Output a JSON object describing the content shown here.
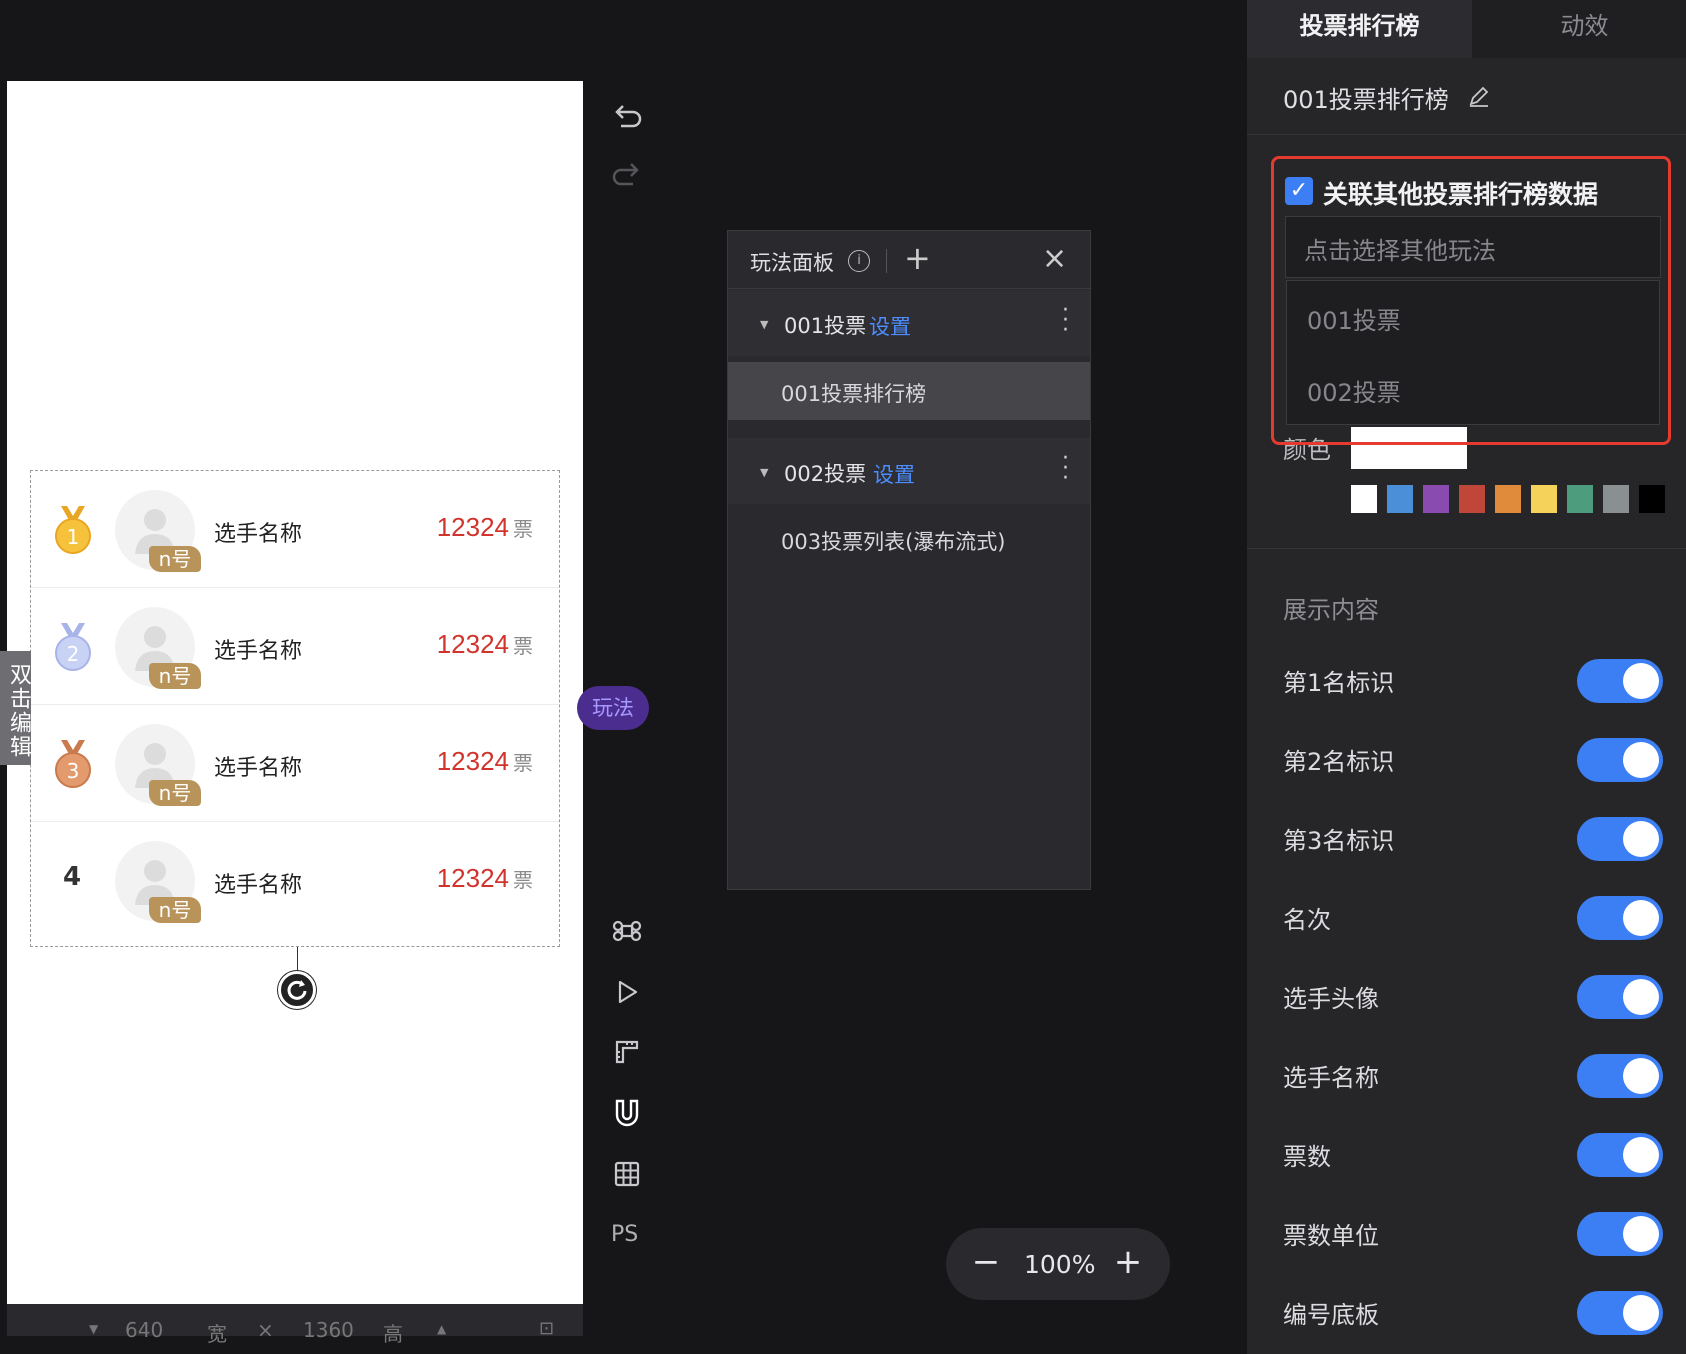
{
  "canvas": {
    "dbl_edit": "双击编辑",
    "play_pill": "玩法",
    "width_value": "640",
    "width_unit": "宽",
    "height_value": "1360",
    "height_unit": "高",
    "rows": [
      {
        "rank": "1",
        "medal": "gold",
        "name": "选手名称",
        "badge": "n号",
        "votes": "12324",
        "unit": "票"
      },
      {
        "rank": "2",
        "medal": "silver",
        "name": "选手名称",
        "badge": "n号",
        "votes": "12324",
        "unit": "票"
      },
      {
        "rank": "3",
        "medal": "bronze",
        "name": "选手名称",
        "badge": "n号",
        "votes": "12324",
        "unit": "票"
      },
      {
        "rank": "4",
        "medal": "none",
        "name": "选手名称",
        "badge": "n号",
        "votes": "12324",
        "unit": "票"
      }
    ]
  },
  "tools": {
    "icons": [
      "undo-icon",
      "redo-icon",
      "command-icon",
      "play-icon",
      "ruler-icon",
      "magnet-icon",
      "grid-icon"
    ],
    "ps": "PS"
  },
  "game_panel": {
    "title": "玩法面板",
    "groups": [
      {
        "name": "001投票",
        "settings": "设置",
        "children": [
          "001投票排行榜"
        ]
      },
      {
        "name": "002投票",
        "settings": "设置",
        "children": [
          "003投票列表(瀑布流式)"
        ]
      }
    ]
  },
  "zoom": {
    "minus": "−",
    "value": "100%",
    "plus": "+"
  },
  "right_panel": {
    "tabs": [
      "投票排行榜",
      "动效"
    ],
    "title": "001投票排行榜",
    "link_label": "关联其他投票排行榜数据",
    "select_placeholder": "点击选择其他玩法",
    "options": [
      "001投票",
      "002投票"
    ],
    "color_label": "颜色",
    "swatches": [
      "#ffffff",
      "#4a8fd8",
      "#8a4bb0",
      "#c0463a",
      "#e08a3c",
      "#f5d35a",
      "#4e9c7e",
      "#8a8f92",
      "#000000"
    ],
    "display_title": "展示内容",
    "display_items": [
      "第1名标识",
      "第2名标识",
      "第3名标识",
      "名次",
      "选手头像",
      "选手名称",
      "票数",
      "票数单位",
      "编号底板"
    ],
    "accent": "#3c7ff5",
    "highlight": "#e53b2e"
  }
}
